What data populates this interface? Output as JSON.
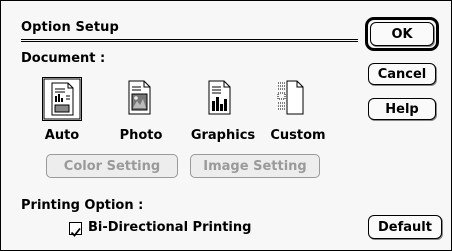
{
  "dialog": {
    "title": "Option Setup"
  },
  "buttons": {
    "ok": "OK",
    "cancel": "Cancel",
    "help": "Help",
    "default": "Default"
  },
  "document": {
    "label": "Document :",
    "types": [
      {
        "label": "Auto",
        "icon": "auto-doc-icon",
        "selected": true
      },
      {
        "label": "Photo",
        "icon": "photo-doc-icon",
        "selected": false
      },
      {
        "label": "Graphics",
        "icon": "graphics-doc-icon",
        "selected": false
      },
      {
        "label": "Custom",
        "icon": "custom-doc-icon",
        "selected": false
      }
    ],
    "color_setting": "Color Setting",
    "image_setting": "Image Setting"
  },
  "printing": {
    "label": "Printing Option :",
    "bidirectional_label": "Bi-Directional Printing",
    "bidirectional_checked": true
  }
}
